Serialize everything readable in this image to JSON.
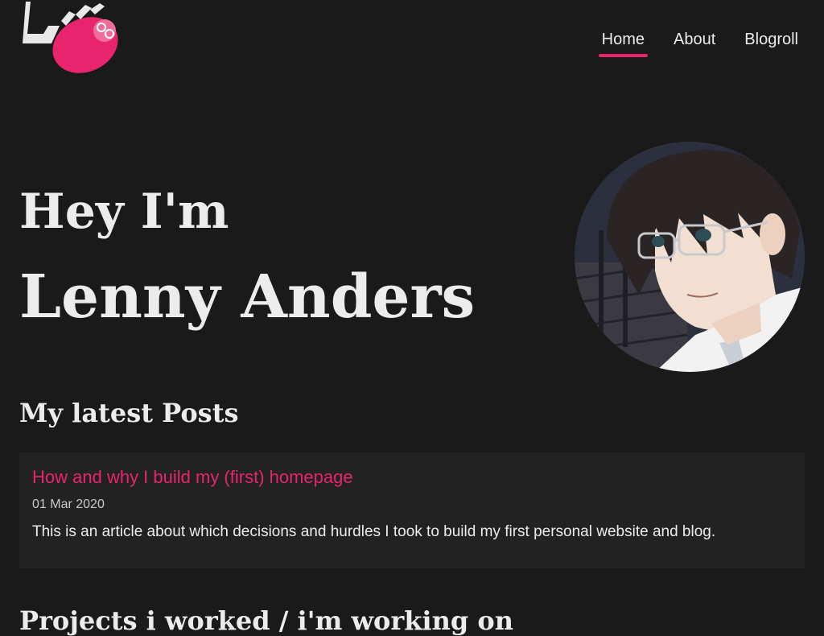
{
  "nav": {
    "items": [
      {
        "label": "Home",
        "active": true
      },
      {
        "label": "About",
        "active": false
      },
      {
        "label": "Blogroll",
        "active": false
      }
    ]
  },
  "hero": {
    "greeting": "Hey I'm",
    "name": "Lenny Anders"
  },
  "posts": {
    "heading": "My latest Posts",
    "items": [
      {
        "title": "How and why I build my (first) homepage",
        "date": "01 Mar 2020",
        "excerpt": "This is an article about which decisions and hurdles I took to build my first personal website and blog."
      }
    ]
  },
  "next_section": {
    "heading": "Projects i worked / i'm working on"
  },
  "colors": {
    "background": "#1b1a1b",
    "accent": "#e8246c",
    "card": "#232223"
  },
  "icons": {
    "logo": "sloth-logo",
    "avatar": "anime-portrait-avatar"
  }
}
